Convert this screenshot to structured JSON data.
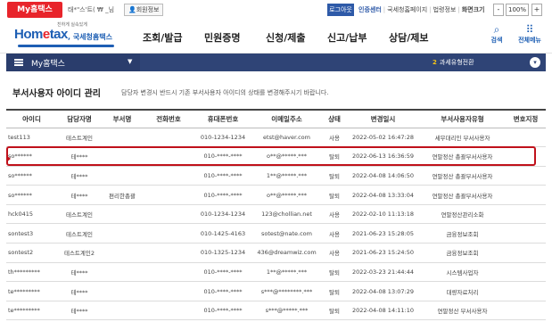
{
  "topbar": {
    "myhome_tab": "My홈택스",
    "breadcrumb": "태*\"스'트( ₩ _님",
    "member_info": "회원정보",
    "logout": "로그아웃",
    "cert_center": "인증센터",
    "link_site": "국세청홈페이지",
    "link_law": "법령정보",
    "link_screen": "화면크기",
    "zoom_minus": "-",
    "zoom_value": "100%",
    "zoom_plus": "+"
  },
  "header": {
    "logo_tagline": "친하게 실속있게",
    "logo_word_1": "Hom",
    "logo_word_2": "e",
    "logo_word_3": "tax",
    "logo_sub": ", 국세청홈택스",
    "nav": [
      "조회/발급",
      "민원증명",
      "신청/제출",
      "신고/납부",
      "상담/제보"
    ],
    "search_label": "검색",
    "allmenu_label": "전체메뉴",
    "search_icon_glyph": "⌕",
    "allmenu_icon_glyph": "⠿"
  },
  "mybar": {
    "title": "My홈택스",
    "caret": "▼",
    "switch_num": "2",
    "switch_text": "과세유형전환",
    "circle": "▾"
  },
  "page": {
    "title": "부서사용자 아이디 관리",
    "notice": "담당자 변경시 반드시 기존 부서사용자 아이디의 상태를 변경해주시기 바랍니다."
  },
  "table": {
    "headers": [
      "아이디",
      "담당자명",
      "부서명",
      "전화번호",
      "휴대폰번호",
      "이메일주소",
      "상태",
      "변경일시",
      "부서사용자유형",
      "변호지정"
    ],
    "rows": [
      [
        "test113",
        "테스트계인",
        "",
        "",
        "010-1234-1234",
        "etst@haver.com",
        "사용",
        "2022-05-02 16:47:28",
        "세무대리인 부서사용자",
        ""
      ],
      [
        "so******",
        "테****",
        "",
        "",
        "010-****-****",
        "o**@*****.***",
        "탈퇴",
        "2022-06-13 16:36:59",
        "연말정산 총괄부서사용자",
        ""
      ],
      [
        "so******",
        "테****",
        "",
        "",
        "010-****-****",
        "1**@*****.***",
        "탈퇴",
        "2022-04-08 14:06:50",
        "연말정산 총괄부서사용자",
        ""
      ],
      [
        "so******",
        "테****",
        "편리한총괄",
        "",
        "010-****-****",
        "o**@*****.***",
        "탈퇴",
        "2022-04-08 13:33:04",
        "연말정산 총괄부서사용자",
        ""
      ],
      [
        "hck0415",
        "테스트계인",
        "",
        "",
        "010-1234-1234",
        "123@chollian.net",
        "사용",
        "2022-02-10 11:13:18",
        "연말정산관리소화",
        ""
      ],
      [
        "sontest3",
        "테스트계인",
        "",
        "",
        "010-1425-4163",
        "sotest@nate.com",
        "사용",
        "2021-06-23 15:28:05",
        "금융정보조회",
        ""
      ],
      [
        "sontest2",
        "테스트계인2",
        "",
        "",
        "010-1325-1234",
        "436@dreamwiz.com",
        "사용",
        "2021-06-23 15:24:50",
        "금융정보조회",
        ""
      ],
      [
        "th*********",
        "테****",
        "",
        "",
        "010-****-****",
        "1**@*****.***",
        "탈퇴",
        "2022-03-23 21:44:44",
        "시스템사업자",
        ""
      ],
      [
        "te*********",
        "테****",
        "",
        "",
        "010-****-****",
        "s***@********.***",
        "탈퇴",
        "2022-04-08 13:07:29",
        "대량자료처리",
        ""
      ],
      [
        "te*********",
        "테****",
        "",
        "",
        "010-****-****",
        "s***@*****.***",
        "탈퇴",
        "2022-04-08 14:11:10",
        "연말정산 부서사용자",
        ""
      ]
    ]
  },
  "colors": {
    "brand_red": "#e8242b",
    "brand_blue": "#1e5fb4",
    "navbar": "#2f4476",
    "highlight": "#c0111b"
  }
}
